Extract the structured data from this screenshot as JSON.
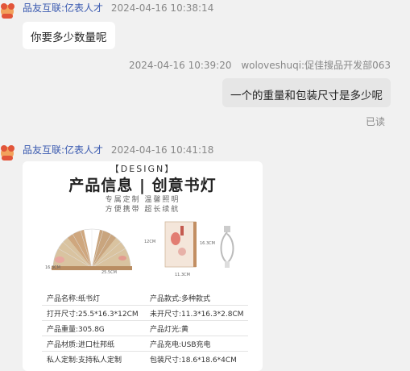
{
  "messages": [
    {
      "sender": "品友互联:亿表人才",
      "time": "2024-04-16 10:38:14",
      "text": "你要多少数量呢"
    },
    {
      "sender": "woloveshuqi:促佳搜品开发部063",
      "time": "2024-04-16 10:39:20",
      "text": "一个的重量和包装尺寸是多少呢",
      "status": "已读"
    },
    {
      "sender": "品友互联:亿表人才",
      "time": "2024-04-16 10:41:18"
    }
  ],
  "product_card": {
    "tag": "【DESIGN】",
    "title": "产品信息 | 创意书灯",
    "subtitle_line1": "专属定制 温馨照明",
    "subtitle_line2": "方便携带 超长续航",
    "dims": {
      "depth": "16.3CM",
      "width": "25.5CM",
      "height": "12CM",
      "book_height": "16.3CM",
      "book_width": "11.3CM"
    },
    "specs": [
      {
        "k1": "产品名称:",
        "v1": "纸书灯",
        "k2": "产品款式:",
        "v2": "多种款式"
      },
      {
        "k1": "打开尺寸:",
        "v1": "25.5*16.3*12CM",
        "k2": "未开尺寸:",
        "v2": "11.3*16.3*2.8CM"
      },
      {
        "k1": "产品重量:",
        "v1": "305.8G",
        "k2": "产品灯光:",
        "v2": "黄"
      },
      {
        "k1": "产品材质:",
        "v1": "进口杜邦纸",
        "k2": "产品充电:",
        "v2": "USB充电"
      },
      {
        "k1": "私人定制:",
        "v1": "支持私人定制",
        "k2": "包装尺寸:",
        "v2": "18.6*18.6*4CM"
      }
    ]
  },
  "colors": {
    "background": "#f1f1f1",
    "sender_name": "#3a5ab0",
    "incoming_bubble": "#ffffff",
    "outgoing_bubble": "#e6e6e6"
  }
}
